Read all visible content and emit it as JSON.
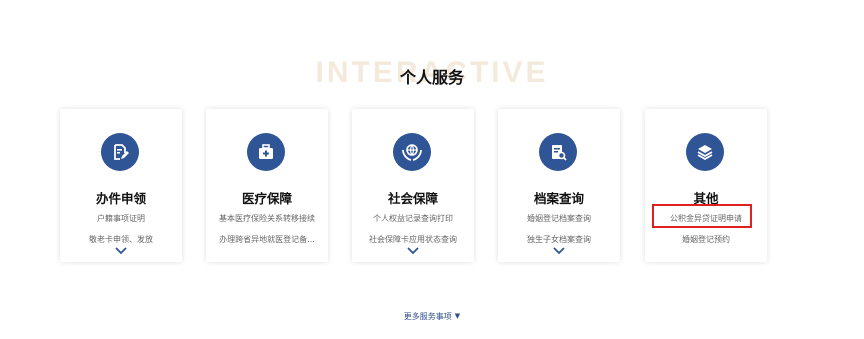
{
  "section": {
    "bg_word": "INTERACTIVE",
    "title": "个人服务"
  },
  "cards": [
    {
      "title": "办件申领",
      "line1": "户籍事项证明",
      "line2": "敬老卡申领、发放",
      "icon": "edit-document-icon"
    },
    {
      "title": "医疗保障",
      "line1": "基本医疗保险关系转移接续",
      "line2": "办理跨省异地就医登记备...",
      "icon": "medical-kit-icon"
    },
    {
      "title": "社会保障",
      "line1": "个人权益记录查询打印",
      "line2": "社会保障卡应用状态查询",
      "icon": "globe-hands-icon"
    },
    {
      "title": "档案查询",
      "line1": "婚姻登记档案查询",
      "line2": "独生子女档案查询",
      "icon": "file-search-icon"
    },
    {
      "title": "其他",
      "line1": "公积金异贷证明申请",
      "line2": "婚姻登记预约",
      "icon": "layers-icon"
    }
  ],
  "more": {
    "label": "更多服务事项",
    "caret": "▼"
  },
  "colors": {
    "accent": "#2f5597",
    "highlight": "#e02020",
    "watermark": "#f3eadc"
  }
}
